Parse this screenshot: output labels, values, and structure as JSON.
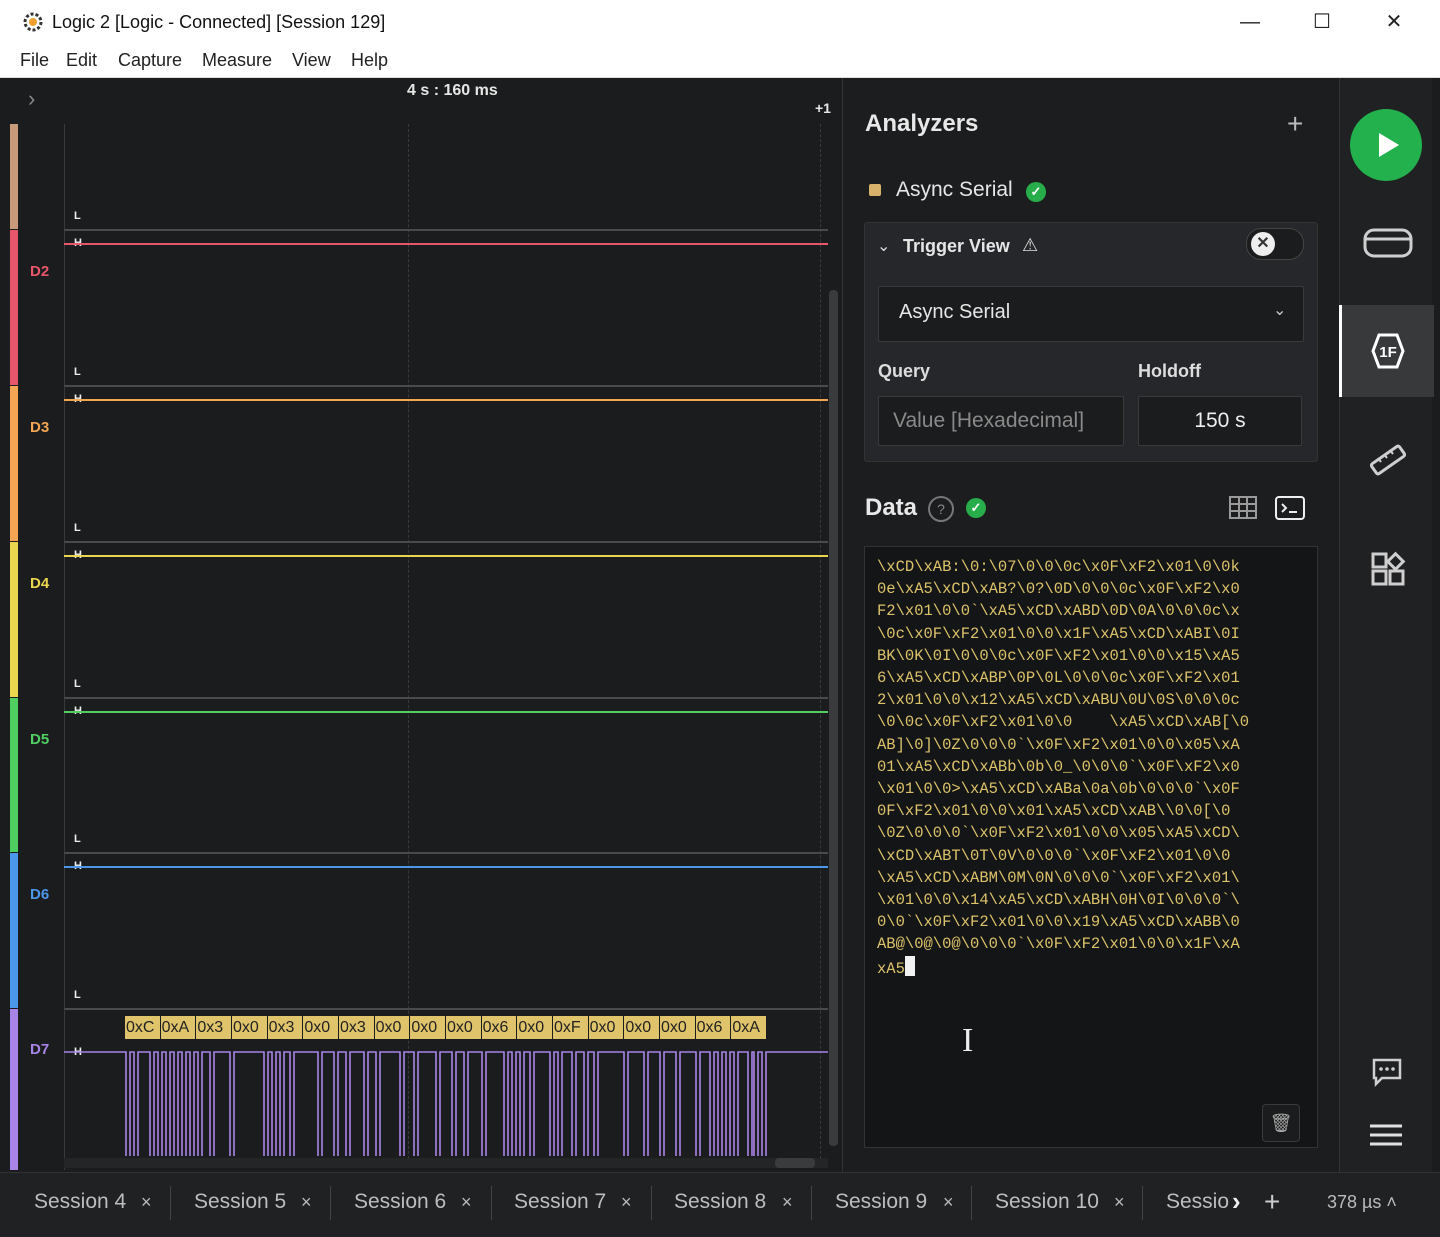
{
  "window": {
    "title": "Logic 2 [Logic - Connected] [Session 129]",
    "controls": {
      "minimize": "—",
      "maximize": "☐",
      "close": "✕"
    }
  },
  "menu": [
    "File",
    "Edit",
    "Capture",
    "Measure",
    "View",
    "Help"
  ],
  "waveform": {
    "time_label": "4 s : 160 ms",
    "offset_label": "+1",
    "high_marker": "H",
    "low_marker": "L",
    "channels": [
      {
        "name": "",
        "color": "#c99a7a"
      },
      {
        "name": "D2",
        "color": "#e8566b"
      },
      {
        "name": "D3",
        "color": "#f2a553"
      },
      {
        "name": "D4",
        "color": "#ead54e"
      },
      {
        "name": "D5",
        "color": "#4fcf62"
      },
      {
        "name": "D6",
        "color": "#4b97e8"
      },
      {
        "name": "D7",
        "color": "#a884e6"
      }
    ],
    "decoded_bytes": [
      "0xC",
      "0xA",
      "0x3",
      "0x0",
      "0x3",
      "0x0",
      "0x3",
      "0x0",
      "0x0",
      "0x0",
      "0x6",
      "0x0",
      "0xF",
      "0x0",
      "0x0",
      "0x0",
      "0x6",
      "0xA"
    ],
    "decode_color": "#e0c46b"
  },
  "analyzers": {
    "title": "Analyzers",
    "add_icon": "plus-icon",
    "items": [
      {
        "name": "Async Serial",
        "status": "ok",
        "color": "#d8b26a"
      }
    ]
  },
  "trigger": {
    "title": "Trigger View",
    "warning_icon": "⚠",
    "analyzer": "Async Serial",
    "query_label": "Query",
    "query_placeholder": "Value [Hexadecimal]",
    "holdoff_label": "Holdoff",
    "holdoff_value": "150 s"
  },
  "data": {
    "title": "Data",
    "terminal_lines": [
      "\\xCD\\xAB:\\0:\\07\\0\\0\\0c\\x0F\\xF2\\x01\\0\\0k",
      "0e\\xA5\\xCD\\xAB?\\0?\\0D\\0\\0\\0c\\x0F\\xF2\\x0",
      "F2\\x01\\0\\0`\\xA5\\xCD\\xABD\\0D\\0A\\0\\0\\0c\\x",
      "\\0c\\x0F\\xF2\\x01\\0\\0\\x1F\\xA5\\xCD\\xABI\\0I",
      "BK\\0K\\0I\\0\\0\\0c\\x0F\\xF2\\x01\\0\\0\\x15\\xA5",
      "6\\xA5\\xCD\\xABP\\0P\\0L\\0\\0\\0c\\x0F\\xF2\\x01",
      "2\\x01\\0\\0\\x12\\xA5\\xCD\\xABU\\0U\\0S\\0\\0\\0c",
      "\\0\\0c\\x0F\\xF2\\x01\\0\\0    \\xA5\\xCD\\xAB[\\0",
      "AB]\\0]\\0Z\\0\\0\\0`\\x0F\\xF2\\x01\\0\\0\\x05\\xA",
      "01\\xA5\\xCD\\xABb\\0b\\0_\\0\\0\\0`\\x0F\\xF2\\x0",
      "\\x01\\0\\0>\\xA5\\xCD\\xABa\\0a\\0b\\0\\0\\0`\\x0F",
      "0F\\xF2\\x01\\0\\0\\x01\\xA5\\xCD\\xAB\\\\0\\0[\\0",
      "\\0Z\\0\\0\\0`\\x0F\\xF2\\x01\\0\\0\\x05\\xA5\\xCD\\",
      "\\xCD\\xABT\\0T\\0V\\0\\0\\0`\\x0F\\xF2\\x01\\0\\0",
      "\\xA5\\xCD\\xABM\\0M\\0N\\0\\0\\0`\\x0F\\xF2\\x01\\",
      "\\x01\\0\\0\\x14\\xA5\\xCD\\xABH\\0H\\0I\\0\\0\\0`\\",
      "0\\0`\\x0F\\xF2\\x01\\0\\0\\x19\\xA5\\xCD\\xABB\\0",
      "AB@\\0@\\0@\\0\\0\\0`\\x0F\\xF2\\x01\\0\\0\\x1F\\xA",
      "xA5"
    ]
  },
  "tabs": [
    {
      "label": "Session 4"
    },
    {
      "label": "Session 5"
    },
    {
      "label": "Session 6"
    },
    {
      "label": "Session 7"
    },
    {
      "label": "Session 8"
    },
    {
      "label": "Session 9"
    },
    {
      "label": "Session 10"
    },
    {
      "label": "Sessio"
    }
  ],
  "tab_close": "×",
  "zoom": "378 µs"
}
